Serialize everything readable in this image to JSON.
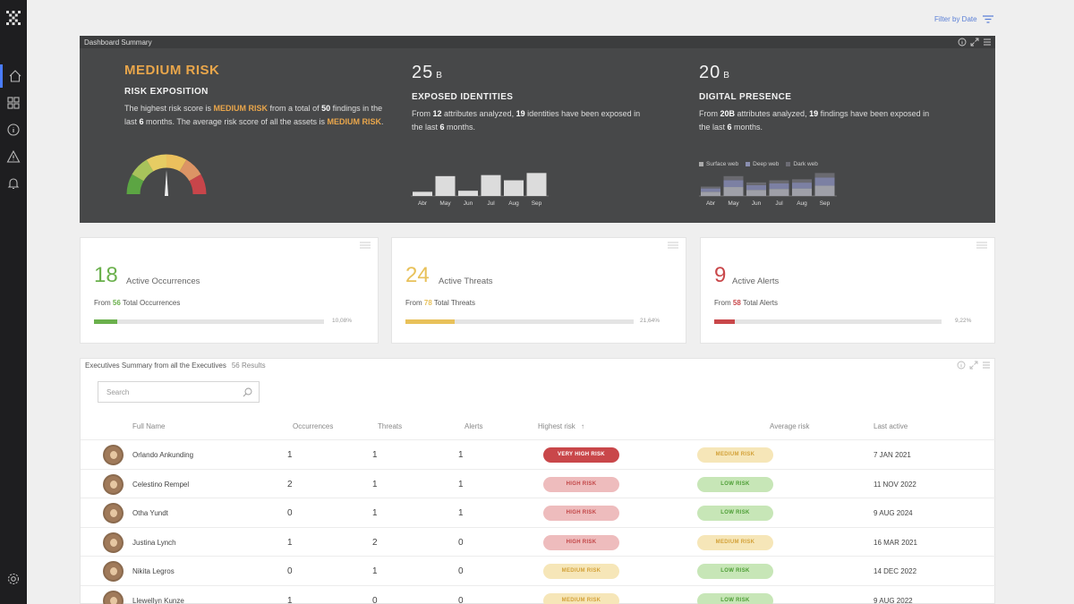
{
  "filter": {
    "label": "Filter by Date"
  },
  "summary": {
    "title": "Dashboard Summary",
    "risk": {
      "level": "MEDIUM RISK",
      "subtitle": "RISK EXPOSITION",
      "text_1": "The highest risk score is ",
      "level_inline": "MEDIUM RISK",
      "text_2": " from a total of ",
      "total": "50",
      "text_3": " findings in the last ",
      "months": "6",
      "text_4": " months. The average risk score of all the assets is ",
      "avg_level": "MEDIUM RISK",
      "text_5": "."
    },
    "identities": {
      "value": "25",
      "unit": "B",
      "subtitle": "EXPOSED IDENTITIES",
      "text_1": "From ",
      "attributes": "12",
      "text_2": " attributes analyzed, ",
      "identities": "19",
      "text_3": " identities have been exposed in the last ",
      "months": "6",
      "text_4": " months.",
      "chart_months": [
        "Abr",
        "May",
        "Jun",
        "Jul",
        "Aug",
        "Sep"
      ],
      "chart_values": [
        4,
        19,
        5,
        20,
        15,
        22
      ]
    },
    "presence": {
      "value": "20",
      "unit": "B",
      "subtitle": "DIGITAL PRESENCE",
      "text_1": "From ",
      "attributes": "20B",
      "text_2": " attributes analyzed, ",
      "findings": "19",
      "text_3": " findings have been exposed in the last ",
      "months": "6",
      "text_4": " months.",
      "legend": [
        "Surface web",
        "Deep web",
        "Dark web"
      ],
      "chart_months": [
        "Abr",
        "May",
        "Jun",
        "Jul",
        "Aug",
        "Sep"
      ],
      "chart_values": [
        9,
        19,
        13,
        15,
        16,
        22
      ]
    }
  },
  "cards": [
    {
      "value": "18",
      "label": "Active Occurrences",
      "from": "From ",
      "total": "56",
      "total_label": " Total Occurrences",
      "pct": "10,08%",
      "fraction": 0.1008,
      "color": "#6ab04c"
    },
    {
      "value": "24",
      "label": "Active Threats",
      "from": "From ",
      "total": "78",
      "total_label": " Total Threats",
      "pct": "21,64%",
      "fraction": 0.2164,
      "color": "#e8c15a"
    },
    {
      "value": "9",
      "label": "Active Alerts",
      "from": "From ",
      "total": "58",
      "total_label": " Total Alerts",
      "pct": "9,22%",
      "fraction": 0.0922,
      "color": "#c9474a"
    }
  ],
  "executives": {
    "title": "Executives Summary from all the Executives",
    "count": "56 Results",
    "search_placeholder": "Search",
    "columns": [
      "Full Name",
      "Occurrences",
      "Threats",
      "Alerts",
      "Highest risk",
      "Average risk",
      "Last active"
    ],
    "rows": [
      {
        "name": "Orlando Ankunding",
        "occ": "1",
        "thr": "1",
        "alr": "1",
        "high": "VERY HIGH RISK",
        "avg": "MEDIUM RISK",
        "last": "7 JAN 2021"
      },
      {
        "name": "Celestino Rempel",
        "occ": "2",
        "thr": "1",
        "alr": "1",
        "high": "HIGH RISK",
        "avg": "LOW RISK",
        "last": "11 NOV 2022"
      },
      {
        "name": "Otha Yundt",
        "occ": "0",
        "thr": "1",
        "alr": "1",
        "high": "HIGH RISK",
        "avg": "LOW RISK",
        "last": "9 AUG 2024"
      },
      {
        "name": "Justina Lynch",
        "occ": "1",
        "thr": "2",
        "alr": "0",
        "high": "HIGH RISK",
        "avg": "MEDIUM RISK",
        "last": "16 MAR 2021"
      },
      {
        "name": "Nikita Legros",
        "occ": "0",
        "thr": "1",
        "alr": "0",
        "high": "MEDIUM RISK",
        "avg": "LOW RISK",
        "last": "14 DEC 2022"
      },
      {
        "name": "Llewellyn Kunze",
        "occ": "1",
        "thr": "0",
        "alr": "0",
        "high": "MEDIUM RISK",
        "avg": "LOW RISK",
        "last": "9 AUG 2022"
      }
    ]
  }
}
